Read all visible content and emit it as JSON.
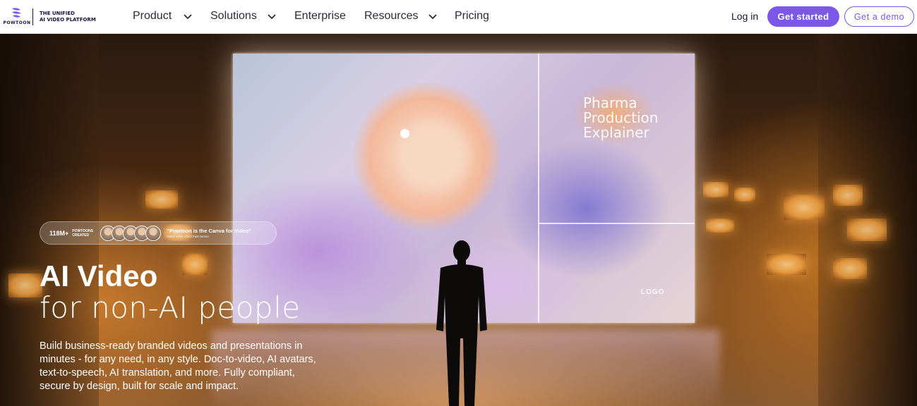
{
  "brand": {
    "logo_icon": "powtoon-logo-icon",
    "wordmark": "POWTOON",
    "tagline_line1": "THE UNIFIED",
    "tagline_line2": "AI VIDEO PLATFORM",
    "accent_color": "#7b57ea"
  },
  "nav": {
    "items": [
      {
        "label": "Product",
        "has_dropdown": true
      },
      {
        "label": "Solutions",
        "has_dropdown": true
      },
      {
        "label": "Enterprise",
        "has_dropdown": false
      },
      {
        "label": "Resources",
        "has_dropdown": true
      },
      {
        "label": "Pricing",
        "has_dropdown": false
      }
    ],
    "login_label": "Log in",
    "primary_cta": "Get started",
    "secondary_cta": "Get a demo"
  },
  "hero": {
    "screen": {
      "title_line1": "Pharma",
      "title_line2": "Production",
      "title_line3": "Explainer",
      "logo_text": "LOGO"
    },
    "proof": {
      "count": "118M+",
      "label_line1": "POWTOONS",
      "label_line2": "CREATED",
      "avatar_count": 5,
      "quote": "“Powtoon is the Canva for Video”",
      "attribution": "David Suter, CEO Fast Sense"
    },
    "headline_bold": "AI Video",
    "headline_light": "for non-AI people",
    "description": "Build business-ready branded videos and presentations in minutes - for any need, in any style. Doc-to-video, AI avatars, text-to-speech, AI translation, and more. Fully compliant, secure by design, built for scale and impact."
  }
}
